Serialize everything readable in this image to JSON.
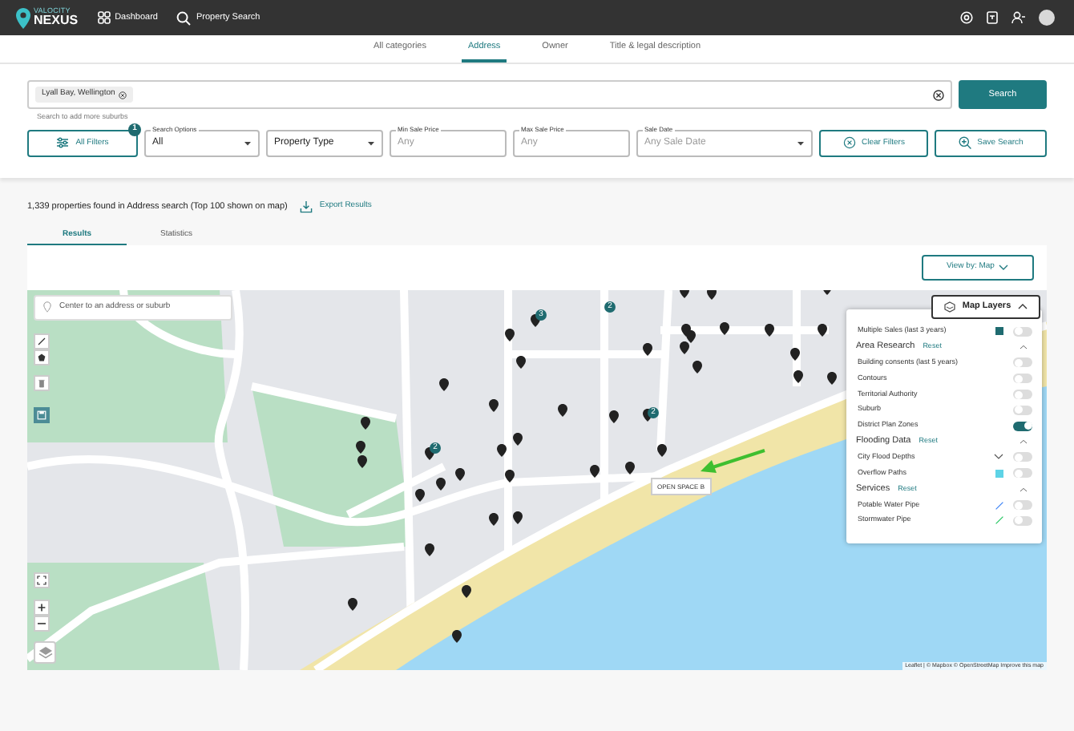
{
  "header": {
    "logo_top": "VALOCITY",
    "logo_bottom": "NEXUS",
    "nav": [
      {
        "label": "Dashboard",
        "kind": "grid"
      },
      {
        "label": "Property Search",
        "kind": "search"
      }
    ]
  },
  "category_tabs": [
    {
      "label": "All categories",
      "selected": false
    },
    {
      "label": "Address",
      "selected": true
    },
    {
      "label": "Owner",
      "selected": false
    },
    {
      "label": "Title & legal description",
      "selected": false
    }
  ],
  "search": {
    "chips": [
      "Lyall Bay, Wellington"
    ],
    "hint": "Search to add more suburbs",
    "button": "Search"
  },
  "filters": {
    "all_filters": {
      "label": "All Filters",
      "badge": "1"
    },
    "fields": [
      {
        "label": "Search Options",
        "value": "All",
        "kind": "select"
      },
      {
        "placeholder": "Property Type",
        "kind": "select"
      },
      {
        "label": "Min Sale Price",
        "placeholder": "Any",
        "kind": "input"
      },
      {
        "label": "Max Sale Price",
        "placeholder": "Any",
        "kind": "input"
      },
      {
        "label": "Sale Date",
        "placeholder": "Any Sale Date",
        "kind": "select"
      }
    ],
    "clear": "Clear Filters",
    "save": "Save Search"
  },
  "results": {
    "summary": "1,339 properties found in Address search (Top 100 shown on map)",
    "export": "Export Results"
  },
  "result_tabs": [
    {
      "label": "Results",
      "selected": true
    },
    {
      "label": "Statistics",
      "selected": false
    }
  ],
  "view_by": "View by: Map",
  "map": {
    "search_placeholder": "Center to an address or suburb",
    "clusters": [
      "3",
      "2",
      "2",
      "2"
    ],
    "tooltip": "OPEN SPACE B",
    "attribution": "Leaflet | © Mapbox © OpenStreetMap Improve this map"
  },
  "map_layers": {
    "title": "Map Layers",
    "expanded": true,
    "top_items": [
      {
        "label": "Multiple Sales (last 3 years)",
        "on": false,
        "kind": "swatch",
        "color": "#1f6b70"
      }
    ],
    "sections": [
      {
        "title": "Area Research",
        "reset": "Reset",
        "expanded": true,
        "items": [
          {
            "label": "Building consents (last 5 years)",
            "on": false,
            "kind": "plain"
          },
          {
            "label": "Contours",
            "on": false,
            "kind": "plain"
          },
          {
            "label": "Territorial Authority",
            "on": false,
            "kind": "plain"
          },
          {
            "label": "Suburb",
            "on": false,
            "kind": "plain"
          },
          {
            "label": "District Plan Zones",
            "on": true,
            "kind": "plain"
          }
        ]
      },
      {
        "title": "Flooding Data",
        "reset": "Reset",
        "expanded": true,
        "items": [
          {
            "label": "City Flood Depths",
            "on": false,
            "kind": "chevron"
          },
          {
            "label": "Overflow Paths",
            "on": false,
            "kind": "swatch",
            "color": "#5ed3e6"
          }
        ]
      },
      {
        "title": "Services",
        "reset": "Reset",
        "expanded": true,
        "items": [
          {
            "label": "Potable Water Pipe",
            "on": false,
            "kind": "line",
            "color": "#3b82f6"
          },
          {
            "label": "Stormwater Pipe",
            "on": false,
            "kind": "line",
            "color": "#22c55e"
          }
        ]
      }
    ]
  }
}
